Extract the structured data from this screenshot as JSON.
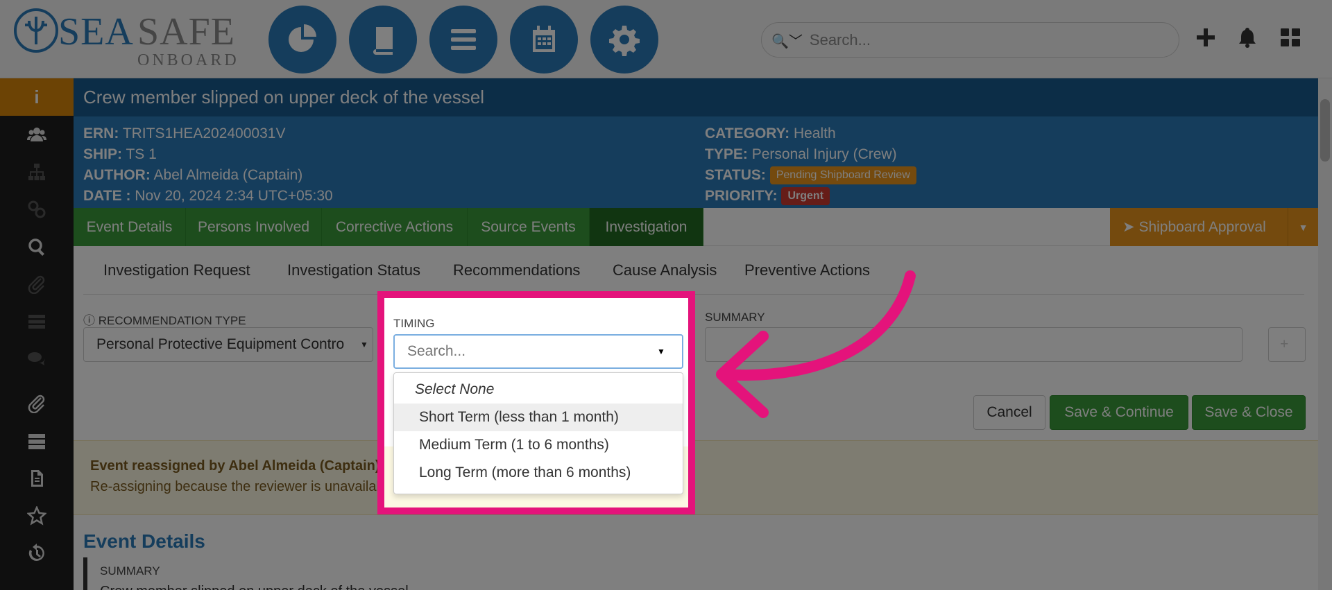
{
  "logo": {
    "sea": "SEA",
    "safe": "SAFE",
    "onboard": "ONBOARD"
  },
  "nav_icons": [
    "pie-chart-icon",
    "book-icon",
    "menu-icon",
    "calendar-icon",
    "gear-icon"
  ],
  "search": {
    "placeholder": "Search..."
  },
  "top_right_icons": [
    "plus-icon",
    "bell-icon",
    "dashboard-grid-icon"
  ],
  "sidebar": {
    "icons": [
      "info-icon",
      "users-icon",
      "sitemap-icon",
      "link-icon",
      "search-icon",
      "paperclip-icon",
      "list-icon",
      "comments-icon",
      "paperclip-icon",
      "server-icon",
      "document-icon",
      "star-icon",
      "history-icon"
    ]
  },
  "event": {
    "title": "Crew member slipped on upper deck of the vessel",
    "ern_label": "ERN:",
    "ern": "TRITS1HEA202400031V",
    "ship_label": "SHIP:",
    "ship": "TS 1",
    "author_label": "AUTHOR:",
    "author": "Abel Almeida (Captain)",
    "date_label": "DATE :",
    "date": "Nov 20, 2024 2:34 UTC+05:30",
    "category_label": "CATEGORY:",
    "category": "Health",
    "type_label": "TYPE:",
    "type": "Personal Injury (Crew)",
    "status_label": "STATUS:",
    "status": "Pending Shipboard Review",
    "priority_label": "PRIORITY:",
    "priority": "Urgent"
  },
  "tabs": [
    {
      "label": "Event Details"
    },
    {
      "label": "Persons Involved"
    },
    {
      "label": "Corrective Actions"
    },
    {
      "label": "Source Events"
    },
    {
      "label": "Investigation"
    }
  ],
  "approval": {
    "label": "Shipboard Approval"
  },
  "subtabs": [
    {
      "label": "Investigation Request"
    },
    {
      "label": "Investigation Status"
    },
    {
      "label": "Recommendations"
    },
    {
      "label": "Cause Analysis"
    },
    {
      "label": "Preventive Actions"
    }
  ],
  "form": {
    "rec_type_label": "RECOMMENDATION TYPE",
    "rec_type_value": "Personal Protective Equipment Contro",
    "timing_label": "TIMING",
    "timing_placeholder": "Search...",
    "summary_label": "SUMMARY",
    "cancel": "Cancel",
    "save_continue": "Save & Continue",
    "save_close": "Save & Close"
  },
  "timing_options": [
    {
      "label": "Select None"
    },
    {
      "label": "Short Term (less than 1 month)"
    },
    {
      "label": "Medium Term (1 to 6 months)"
    },
    {
      "label": "Long Term (more than 6 months)"
    }
  ],
  "notice": {
    "title": "Event reassigned by Abel Almeida (Captain)",
    "message": "Re-assigning because the reviewer is unavailable."
  },
  "details": {
    "heading": "Event Details",
    "summary_label": "SUMMARY",
    "summary_text": "Crew member slipped on upper deck of the vessel"
  },
  "colors": {
    "primary": "#2a7ab8",
    "dark_primary": "#185a8f",
    "green": "#3a9b3a",
    "orange": "#e8951c",
    "urgent": "#cc3a31",
    "highlight": "#e4137b"
  }
}
